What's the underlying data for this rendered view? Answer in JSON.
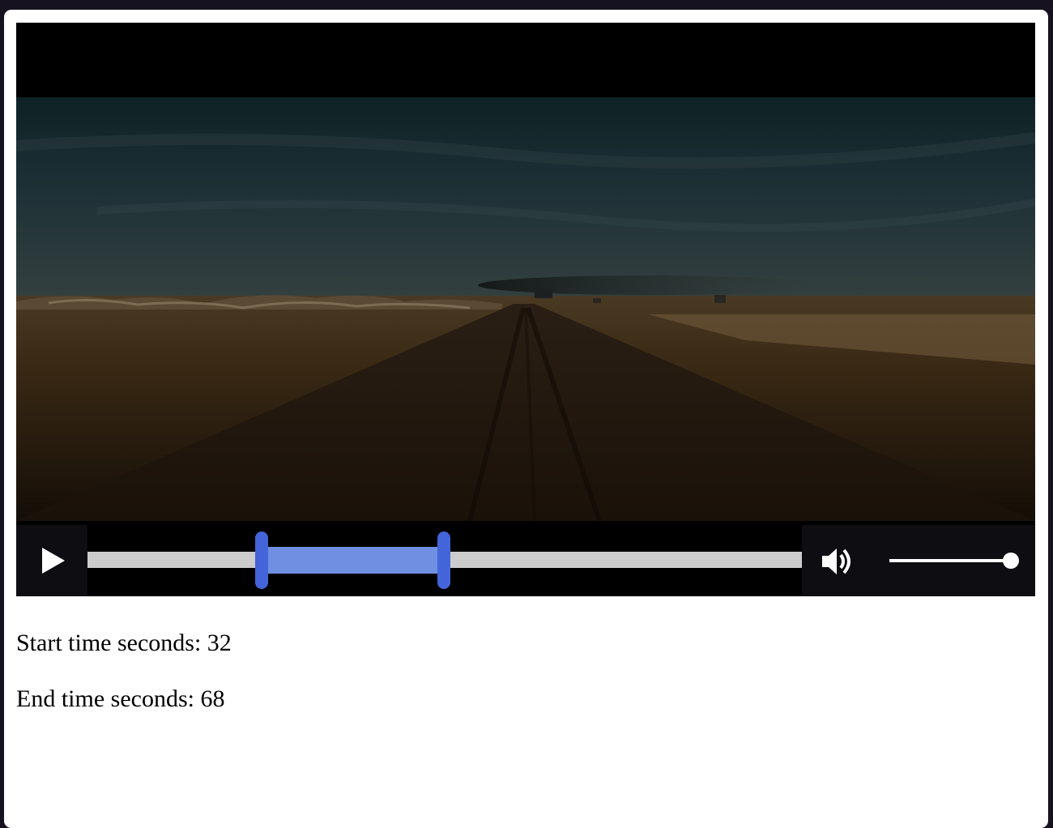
{
  "player": {
    "video": {
      "description_icon": "video-frame"
    },
    "controls": {
      "play_icon": "play-icon",
      "volume_icon": "speaker-icon",
      "volume_level": 1.0
    },
    "trim": {
      "start_fraction": 0.244,
      "end_fraction": 0.499
    }
  },
  "info": {
    "start_label": "Start time seconds:",
    "start_value": "32",
    "end_label": "End time seconds:",
    "end_value": "68"
  },
  "colors": {
    "range_fill": "#6f8fe3",
    "handle": "#4464d9",
    "track": "#cccccc"
  }
}
